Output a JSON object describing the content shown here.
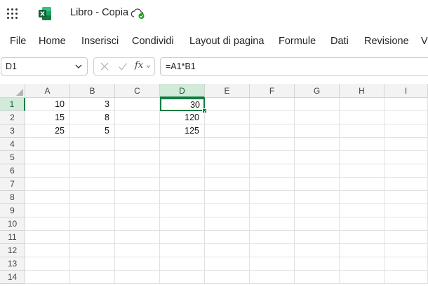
{
  "titlebar": {
    "doc_title": "Libro - Copia",
    "app_icon": "excel-logo",
    "status_icon": "cloud-saved-icon"
  },
  "menu": {
    "items": [
      "File",
      "Home",
      "Inserisci",
      "Condividi",
      "Layout di pagina",
      "Formule",
      "Dati",
      "Revisione",
      "V"
    ]
  },
  "formula_bar": {
    "name_box": "D1",
    "formula": "=A1*B1",
    "fx_label": "fx"
  },
  "grid": {
    "columns": [
      "A",
      "B",
      "C",
      "D",
      "E",
      "F",
      "G",
      "H",
      "I"
    ],
    "rows": [
      "1",
      "2",
      "3",
      "4",
      "5",
      "6",
      "7",
      "8",
      "9",
      "10",
      "11",
      "12",
      "13",
      "14"
    ],
    "selected_column": "D",
    "selected_row": "1",
    "cells": {
      "A1": "10",
      "B1": "3",
      "D1": "30",
      "A2": "15",
      "B2": "8",
      "D2": "120",
      "A3": "25",
      "B3": "5",
      "D3": "125"
    }
  },
  "colors": {
    "accent": "#107c41",
    "header_bg": "#f3f3f3",
    "selected_header_bg": "#d2ead9"
  }
}
